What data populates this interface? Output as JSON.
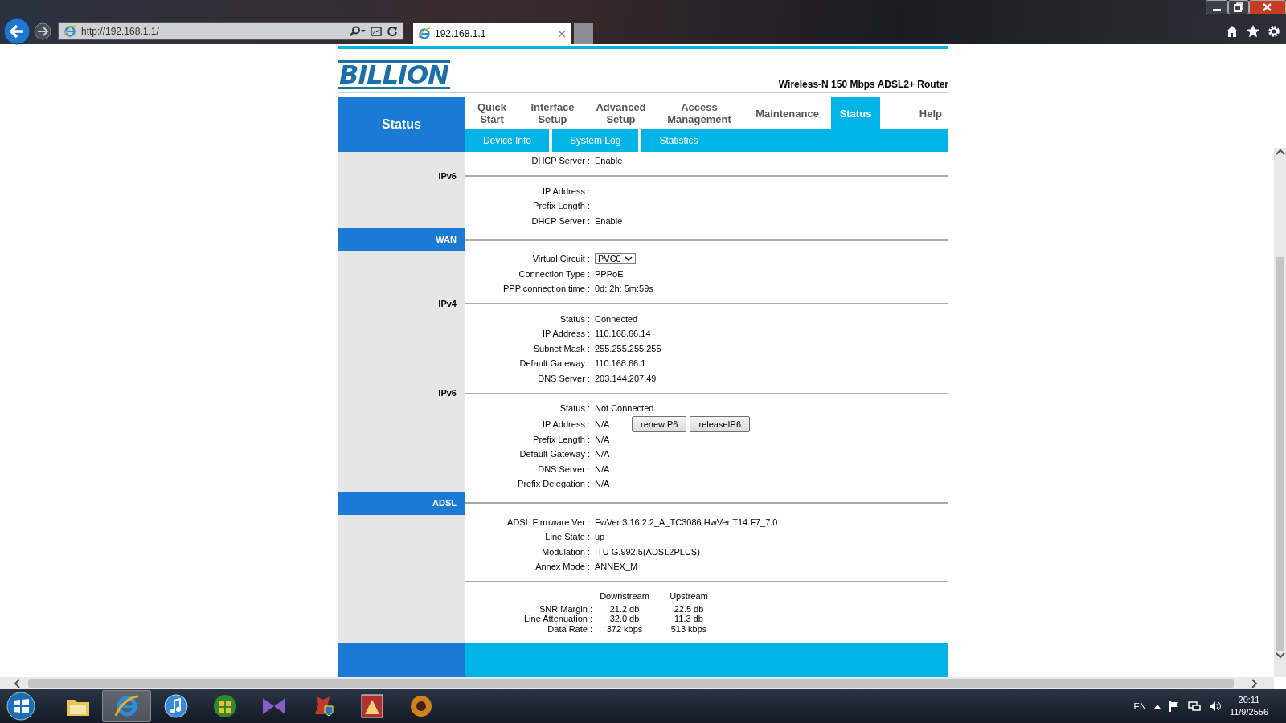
{
  "browser": {
    "address": "http://192.168.1.1/",
    "tab_title": "192.168.1.1"
  },
  "header": {
    "logo": "BILLION",
    "product": "Wireless-N 150 Mbps ADSL2+ Router"
  },
  "sidebar_title": "Status",
  "nav": [
    {
      "label": "Quick Start",
      "selected": false
    },
    {
      "label": "Interface Setup",
      "selected": false
    },
    {
      "label": "Advanced Setup",
      "selected": false
    },
    {
      "label": "Access Management",
      "selected": false
    },
    {
      "label": "Maintenance",
      "selected": false
    },
    {
      "label": "Status",
      "selected": true
    },
    {
      "label": "Help",
      "selected": false
    }
  ],
  "subnav": [
    "Device Info",
    "System Log",
    "Statistics"
  ],
  "sections": [
    {
      "kind": "group",
      "rows": [
        {
          "kind": "text",
          "label": "DHCP Server :",
          "value": "Enable"
        }
      ]
    },
    {
      "kind": "group",
      "label": "IPv6",
      "rows": [
        {
          "kind": "text",
          "label": "IP Address :"
        },
        {
          "kind": "text",
          "label": "Prefix Length :"
        },
        {
          "kind": "text",
          "label": "DHCP Server :",
          "value": "Enable"
        }
      ]
    },
    {
      "kind": "band",
      "label": "WAN"
    },
    {
      "kind": "group",
      "rows": [
        {
          "kind": "select",
          "label": "Virtual Circuit :",
          "value": "PVC0"
        },
        {
          "kind": "text",
          "label": "Connection Type :",
          "value": "PPPoE"
        },
        {
          "kind": "text",
          "label": "PPP connection time :",
          "value": "0d: 2h: 5m:59s"
        }
      ]
    },
    {
      "kind": "group",
      "label": "IPv4",
      "rows": [
        {
          "kind": "text",
          "label": "Status :",
          "value": "Connected"
        },
        {
          "kind": "text",
          "label": "IP Address :",
          "value": "110.168.66.14"
        },
        {
          "kind": "text",
          "label": "Subnet Mask :",
          "value": "255.255.255.255"
        },
        {
          "kind": "text",
          "label": "Default Gateway :",
          "value": "110.168.66.1"
        },
        {
          "kind": "text",
          "label": "DNS Server :",
          "value": "203.144.207.49"
        }
      ]
    },
    {
      "kind": "group",
      "label": "IPv6",
      "rows": [
        {
          "kind": "text",
          "label": "Status :",
          "value": "Not Connected"
        },
        {
          "kind": "buttons",
          "label": "IP Address :",
          "value": "N/A",
          "buttons": [
            "renewIP6",
            "releaseIP6"
          ]
        },
        {
          "kind": "text",
          "label": "Prefix Length :",
          "value": "N/A"
        },
        {
          "kind": "text",
          "label": "Default Gateway :",
          "value": "N/A"
        },
        {
          "kind": "text",
          "label": "DNS Server :",
          "value": "N/A"
        },
        {
          "kind": "text",
          "label": "Prefix Delegation :",
          "value": "N/A"
        }
      ]
    },
    {
      "kind": "band",
      "label": "ADSL"
    },
    {
      "kind": "group",
      "rows": [
        {
          "kind": "text",
          "label": "ADSL Firmware Ver :",
          "value": "FwVer:3.16.2.2_A_TC3086 HwVer:T14.F7_7.0"
        },
        {
          "kind": "text",
          "label": "Line State :",
          "value": "up"
        },
        {
          "kind": "text",
          "label": "Modulation :",
          "value": "ITU G.992.5(ADSL2PLUS)"
        },
        {
          "kind": "text",
          "label": "Annex Mode :",
          "value": "ANNEX_M"
        }
      ]
    },
    {
      "kind": "stats",
      "columns": [
        "Downstream",
        "Upstream"
      ],
      "rows": [
        {
          "label": "SNR Margin :",
          "values": [
            "21.2 db",
            "22.5 db"
          ]
        },
        {
          "label": "Line Attenuation :",
          "values": [
            "32.0 db",
            "11.3 db"
          ]
        },
        {
          "label": "Data Rate :",
          "values": [
            "372 kbps",
            "513 kbps"
          ]
        }
      ]
    }
  ],
  "taskbar": {
    "language": "EN",
    "time": "20:11",
    "date": "11/9/2556"
  }
}
